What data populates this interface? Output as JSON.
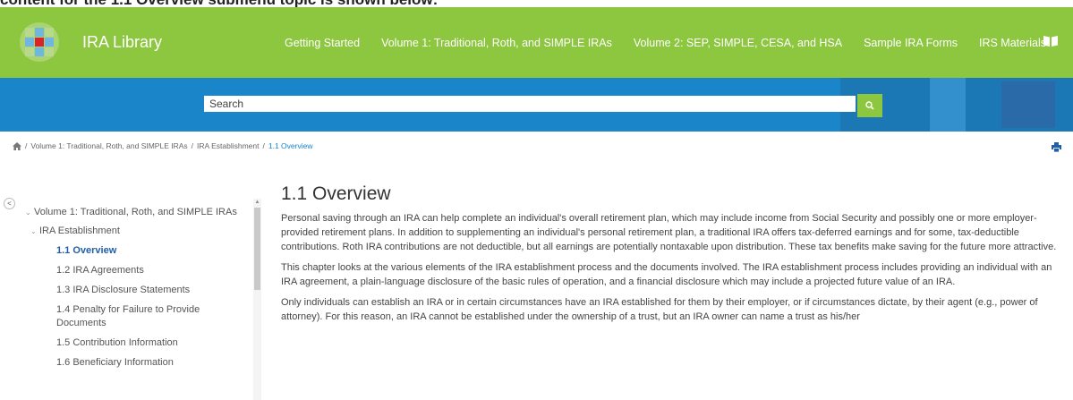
{
  "caption": "content for the 1.1 Overview submenu topic is shown below:",
  "header": {
    "brand": "IRA Library",
    "nav": [
      "Getting Started",
      "Volume 1: Traditional, Roth, and SIMPLE IRAs",
      "Volume 2: SEP, SIMPLE, CESA, and HSA",
      "Sample IRA Forms",
      "IRS Materials"
    ],
    "icons": [
      "logo",
      "book-icon"
    ]
  },
  "search": {
    "placeholder": "Search",
    "button_icon": "search-icon"
  },
  "breadcrumb": {
    "items": [
      "Volume 1: Traditional, Roth, and SIMPLE IRAs",
      "IRA Establishment",
      "1.1 Overview"
    ],
    "separator": "/"
  },
  "sidebar": {
    "collapse_label": "<",
    "root": "Volume 1: Traditional, Roth, and SIMPLE IRAs",
    "section": "IRA Establishment",
    "items": [
      "1.1 Overview",
      "1.2 IRA Agreements",
      "1.3 IRA Disclosure Statements",
      "1.4 Penalty for Failure to Provide Documents",
      "1.5 Contribution Information",
      "1.6 Beneficiary Information"
    ],
    "active_index": 0
  },
  "content": {
    "title": "1.1 Overview",
    "paragraphs": [
      "Personal saving through an IRA can help complete an individual's overall retirement plan, which may include income from Social Security and possibly one or more employer-provided retirement plans. In addition to supplementing an individual's personal retirement plan, a traditional IRA offers tax-deferred earnings and for some, tax-deductible contributions. Roth IRA contributions are not deductible, but all earnings are potentially nontaxable upon distribution. These tax benefits make saving for the future more attractive.",
      "This chapter looks at the various elements of the IRA establishment process and the documents involved. The IRA establishment process includes providing an individual with an IRA agreement, a plain-language disclosure of the basic rules of operation, and a financial disclosure which may include a projected future value of an IRA.",
      "Only individuals can establish an IRA or in certain circumstances have an IRA established for them by their employer, or if circumstances dictate, by their agent (e.g., power of attorney). For this reason, an IRA cannot be established under the ownership of a trust, but an IRA owner can name a trust as his/her"
    ]
  },
  "colors": {
    "header_green": "#8dc63f",
    "search_blue": "#1a85c8",
    "link_blue": "#1a85c8",
    "active_blue": "#1f5ea8"
  }
}
